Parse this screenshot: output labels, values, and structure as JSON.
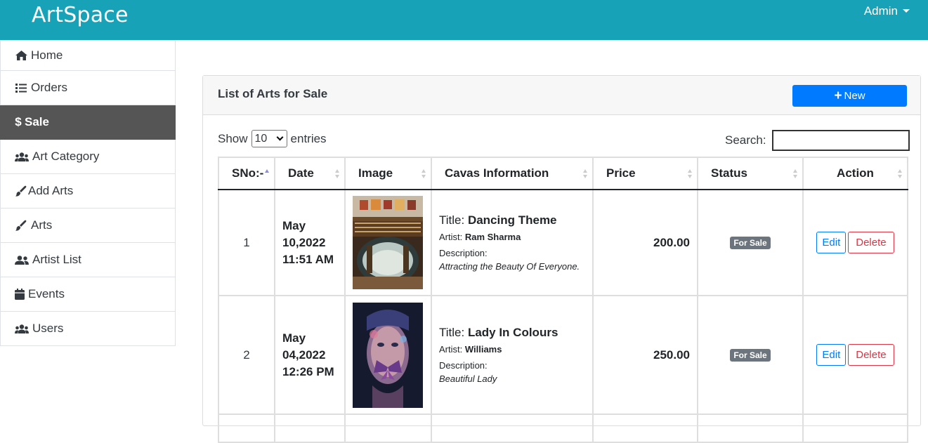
{
  "app": {
    "brand": "ArtSpace",
    "user_menu": "Admin"
  },
  "sidebar": {
    "items": [
      {
        "label": "Home",
        "icon": "home-icon"
      },
      {
        "label": "Orders",
        "icon": "list-icon"
      },
      {
        "label": "Sale",
        "icon": "dollar-icon",
        "active": true
      },
      {
        "label": "Art Category",
        "icon": "users-icon"
      },
      {
        "label": "Add Arts",
        "icon": "brush-icon"
      },
      {
        "label": "Arts",
        "icon": "brush-icon"
      },
      {
        "label": "Artist List",
        "icon": "user-friends-icon"
      },
      {
        "label": "Events",
        "icon": "calendar-icon"
      },
      {
        "label": "Users",
        "icon": "users-icon"
      }
    ]
  },
  "card": {
    "title": "List of Arts for Sale",
    "new_button": "New",
    "show_label": "Show",
    "entries_value": "10",
    "entries_label": "entries",
    "search_label": "Search:",
    "search_value": ""
  },
  "table": {
    "headers": [
      "SNo:-",
      "Date",
      "Image",
      "Cavas Information",
      "Price",
      "Status",
      "Action"
    ],
    "rows": [
      {
        "sno": "1",
        "date_1": "May",
        "date_2": "10,2022",
        "date_3": "11:51 AM",
        "title_prefix": "Title: ",
        "title": "Dancing Theme",
        "artist_prefix": "Artist: ",
        "artist": "Ram Sharma",
        "desc_label": "Description:",
        "desc": "Attracting the Beauty Of Everyone.",
        "price": "200.00",
        "status": "For Sale",
        "edit": "Edit",
        "delete": "Delete"
      },
      {
        "sno": "2",
        "date_1": "May",
        "date_2": "04,2022",
        "date_3": "12:26 PM",
        "title_prefix": "Title: ",
        "title": "Lady In Colours",
        "artist_prefix": "Artist: ",
        "artist": "Williams",
        "desc_label": "Description:",
        "desc": "Beautiful Lady",
        "price": "250.00",
        "status": "For Sale",
        "edit": "Edit",
        "delete": "Delete"
      }
    ]
  },
  "colors": {
    "topbar": "#17a2b8",
    "active_sidebar": "#555555",
    "primary": "#007bff",
    "danger": "#dc3545",
    "badge": "#6c757d"
  }
}
